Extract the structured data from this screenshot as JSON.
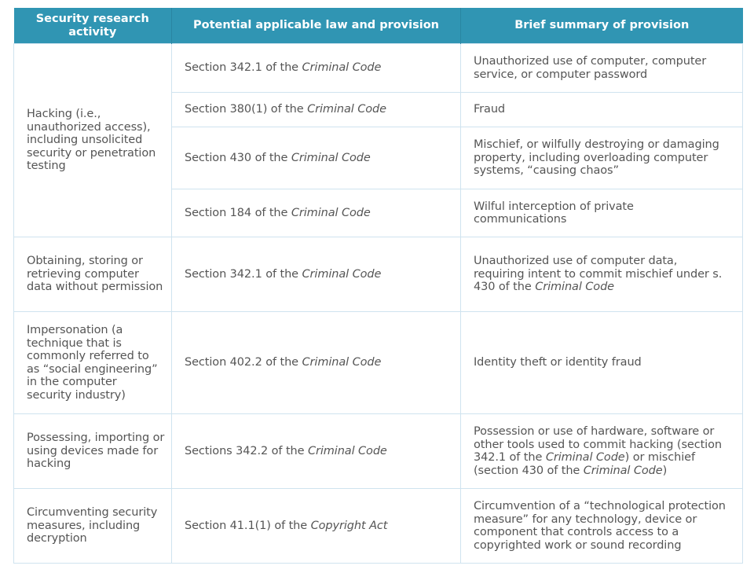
{
  "table": {
    "headers": [
      "Security research activity",
      "Potential applicable law and provision",
      "Brief summary of provision"
    ],
    "accent_color": "#3095b3",
    "rows": [
      {
        "activity": "Hacking (i.e., unauthorized access), including unsolicited security or penetration testing",
        "provisions": [
          {
            "law_prefix": "Section 342.1 of the ",
            "law_italic": "Criminal Code",
            "summary_parts": [
              {
                "text": "Unauthorized use of computer, computer service, or computer password",
                "italic": false
              }
            ]
          },
          {
            "law_prefix": "Section 380(1) of the ",
            "law_italic": "Criminal Code",
            "summary_parts": [
              {
                "text": "Fraud",
                "italic": false
              }
            ]
          },
          {
            "law_prefix": "Section 430 of the ",
            "law_italic": "Criminal Code",
            "summary_parts": [
              {
                "text": "Mischief, or wilfully destroying or damaging property, including overloading computer systems, “causing chaos”",
                "italic": false
              }
            ]
          },
          {
            "law_prefix": "Section 184 of the ",
            "law_italic": "Criminal Code",
            "summary_parts": [
              {
                "text": "Wilful interception of private communications",
                "italic": false
              }
            ]
          }
        ]
      },
      {
        "activity": "Obtaining, storing or retrieving computer data without permission",
        "provisions": [
          {
            "law_prefix": "Section 342.1 of the ",
            "law_italic": "Criminal Code",
            "summary_parts": [
              {
                "text": "Unauthorized use of computer data, requiring intent to commit mischief under s. 430 of the ",
                "italic": false
              },
              {
                "text": "Criminal Code",
                "italic": true
              }
            ]
          }
        ]
      },
      {
        "activity": "Impersonation (a technique that is commonly referred to as “social engineering” in the computer security industry)",
        "provisions": [
          {
            "law_prefix": "Section 402.2 of the ",
            "law_italic": "Criminal Code",
            "summary_parts": [
              {
                "text": "Identity theft or identity fraud",
                "italic": false
              }
            ]
          }
        ]
      },
      {
        "activity": "Possessing, importing or using devices made for hacking",
        "provisions": [
          {
            "law_prefix": "Sections 342.2 of the ",
            "law_italic": "Criminal Code",
            "summary_parts": [
              {
                "text": "Possession or use of hardware, software or other tools used to commit hacking (section 342.1 of the ",
                "italic": false
              },
              {
                "text": "Criminal Code",
                "italic": true
              },
              {
                "text": ") or mischief (section 430 of the ",
                "italic": false
              },
              {
                "text": "Criminal Code",
                "italic": true
              },
              {
                "text": ")",
                "italic": false
              }
            ]
          }
        ]
      },
      {
        "activity": "Circumventing security measures, including decryption",
        "provisions": [
          {
            "law_prefix": "Section 41.1(1) of the ",
            "law_italic": "Copyright Act",
            "summary_parts": [
              {
                "text": "Circumvention of a “technological protection measure” for any technology, device or component that controls access to a copyrighted work or sound recording",
                "italic": false
              }
            ]
          }
        ]
      }
    ]
  }
}
